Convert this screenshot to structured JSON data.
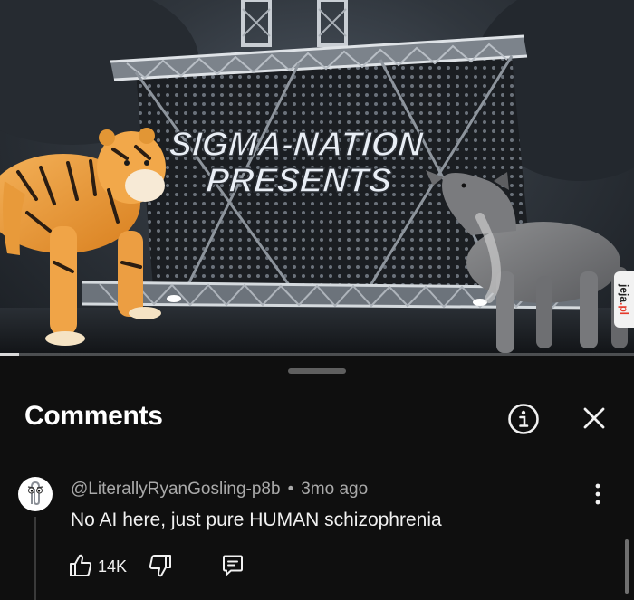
{
  "video": {
    "title_text_line1": "SIGMA-NATION",
    "title_text_line2": "PRESENTS",
    "watermark": {
      "name": "jeja",
      "suffix": ".pl"
    },
    "progress_fraction": 0.03
  },
  "comments_panel": {
    "title": "Comments",
    "info_icon": "info-circle-icon",
    "close_icon": "close-icon"
  },
  "comment": {
    "author": "@LiterallyRyanGosling-p8b",
    "separator": "•",
    "time_ago": "3mo ago",
    "text": "No AI here, just pure HUMAN schizophrenia",
    "like_count": "14K",
    "avatar_icon": "paperclip-assistant-icon",
    "more_icon": "more-vert-icon"
  },
  "colors": {
    "background": "#0f0f0f",
    "text_primary": "#f1f1f1",
    "text_secondary": "#aaaaaa",
    "watermark_accent": "#e53a2b"
  }
}
